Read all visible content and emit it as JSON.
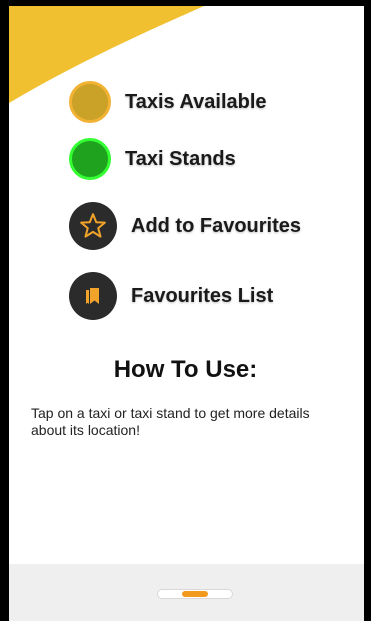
{
  "colors": {
    "accent_yellow": "#f0c030",
    "taxi_available_fill": "#c9a227",
    "taxi_available_ring": "#f2b233",
    "taxi_stand_fill": "#1fa31f",
    "taxi_stand_ring": "#33ff33",
    "icon_dark": "#2b2b2b",
    "pager_active": "#f29a1e"
  },
  "legend": {
    "items": [
      {
        "label": "Taxis Available",
        "icon": "taxi-available-dot"
      },
      {
        "label": "Taxi Stands",
        "icon": "taxi-stand-dot"
      },
      {
        "label": "Add to Favourites",
        "icon": "star-icon"
      },
      {
        "label": "Favourites List",
        "icon": "bookmarks-icon"
      }
    ]
  },
  "how_to_use": {
    "title": "How To Use:",
    "text": "Tap on a taxi or taxi stand to get more details about its location!"
  },
  "pager": {
    "pages": 3,
    "current": 2
  }
}
